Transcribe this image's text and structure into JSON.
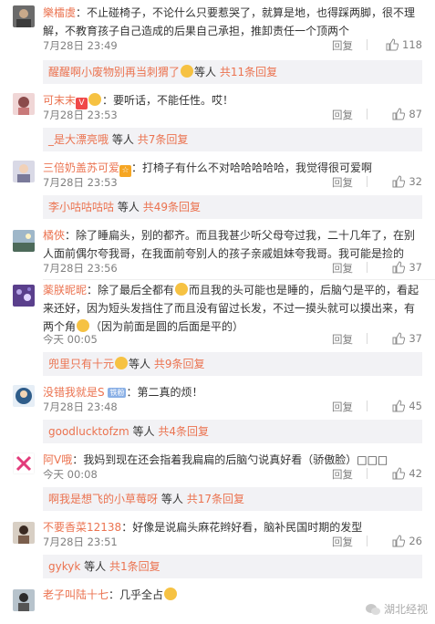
{
  "ui": {
    "reply_label": "回复",
    "sub_mid": "等人",
    "watermark": "湖北经视"
  },
  "comments": [
    {
      "user": "樂檑虞",
      "text": "不止碰椅子，不论什么只要惹哭了，就算是地，也得踩两脚，很不理解，不教育孩子自己造成的后果自己承担，推卸责任一个顶两个",
      "time": "7月28日 23:49",
      "likes": "118",
      "sub": {
        "name": "醒醒啊小废物别再当刺猬了",
        "count": "共11条回复"
      }
    },
    {
      "user": "可末末",
      "text": "要听话，不能任性。哎！",
      "time": "7月28日 23:53",
      "likes": "87",
      "sub": {
        "name": "_是大漂亮哦",
        "count": "共7条回复"
      }
    },
    {
      "user": "三倍奶盖苏可爱",
      "text": "打椅子有什么不对哈哈哈哈哈，我觉得很可爱啊",
      "time": "7月28日 23:53",
      "likes": "32",
      "sub": {
        "name": "李小咕咕咕咕",
        "count": "共49条回复"
      }
    },
    {
      "user": "橘俠",
      "text": "除了睡扁头，别的都齐。而且我甚少听父母夸过我，二十几年了，在别人面前偶尔夸我哥，在我面前夸别人的孩子亲戚姐妹夸我哥。我可能是捡的",
      "time": "7月28日 23:56",
      "likes": "37"
    },
    {
      "user": "薬朕昵昵",
      "text_a": "除了最后全都有",
      "text_b": "而且我的头可能也是睡的，后脑勺是平的，看起来还好，因为短头发挡住了而且没有留过长发，不过一摸头就可以摸出来，有两个角",
      "text_c": "（因为前面是圆的后面是平的）",
      "time": "今天 00:05",
      "likes": "37",
      "sub": {
        "name": "兜里只有十元",
        "count": "共9条回复"
      }
    },
    {
      "user": "没错我就是S",
      "tag": "铁粉",
      "text": "第二真的烦！",
      "time": "7月28日 23:48",
      "likes": "45",
      "sub": {
        "name": "goodlucktofzm",
        "count": "共4条回复"
      }
    },
    {
      "user": "阿V哦",
      "text": "我妈到现在还会指着我扁扁的后脑勺说真好看（骄傲脸）□□□",
      "time": "今天 00:08",
      "likes": "42",
      "sub": {
        "name": "啊我是想飞的小草莓呀",
        "count": "共17条回复"
      }
    },
    {
      "user": "不要香菜12138",
      "text": "好像是说扁头麻花辫好看，脑补民国时期的发型",
      "time": "7月28日 23:51",
      "likes": "26",
      "sub": {
        "name": "gykyk",
        "count": "共1条回复"
      }
    },
    {
      "user": "老子叫陆十七",
      "text": "几乎全占"
    }
  ],
  "colors": {
    "accent": "#eb7350",
    "sub_bg": "#f2f2f5",
    "meta": "#808080"
  }
}
